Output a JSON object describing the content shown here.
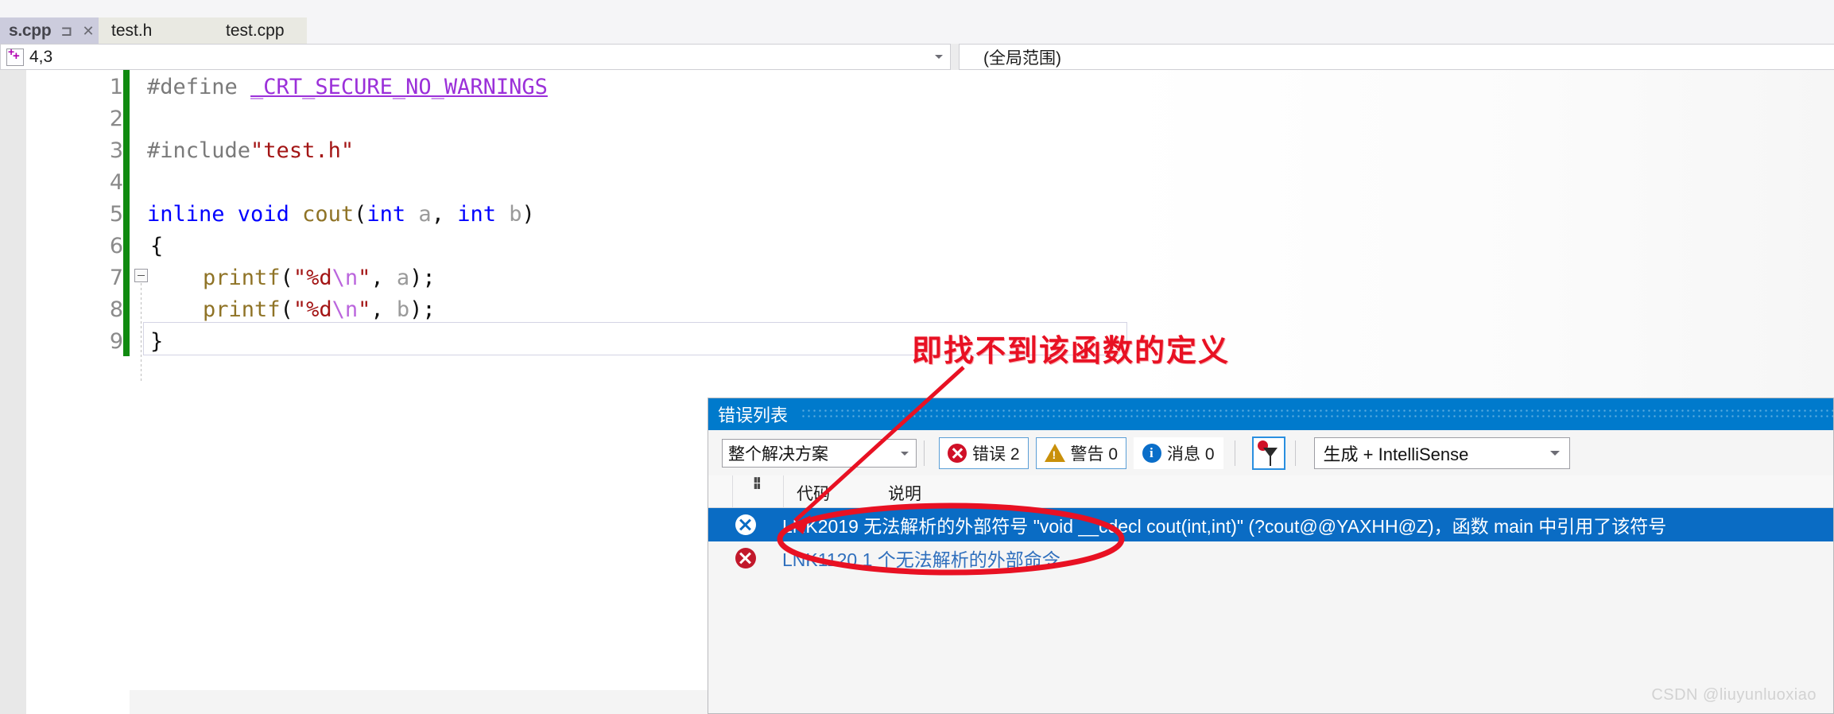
{
  "tabs": [
    {
      "label": "s.cpp",
      "active": true,
      "pin_icon": "pin-icon",
      "close_icon": "close-icon"
    },
    {
      "label": "test.h",
      "active": false
    },
    {
      "label": "test.cpp",
      "active": false
    }
  ],
  "navbar": {
    "left_value": "4,3",
    "left_icon": "member-list-icon",
    "right_value": "(全局范围)",
    "caret_icon": "chevron-down-icon"
  },
  "editor": {
    "line_numbers": [
      "1",
      "2",
      "3",
      "4",
      "5",
      "6",
      "7",
      "8",
      "9"
    ],
    "lines": [
      {
        "n": "1",
        "text": "#define _CRT_SECURE_NO_WARNINGS"
      },
      {
        "n": "2",
        "text": ""
      },
      {
        "n": "3",
        "text": "#include\"test.h\""
      },
      {
        "n": "4",
        "text": ""
      },
      {
        "n": "5",
        "text": "inline void cout(int a, int b)"
      },
      {
        "n": "6",
        "text": "{"
      },
      {
        "n": "7",
        "text": "    printf(\"%d\\n\", a);"
      },
      {
        "n": "8",
        "text": "    printf(\"%d\\n\", b);"
      },
      {
        "n": "9",
        "text": "}"
      }
    ],
    "tokens": {
      "l1_define": "#define ",
      "l1_macro": "_CRT_SECURE_NO_WARNINGS",
      "l3_include": "#include",
      "l3_file": "\"test.h\"",
      "l5_inline": "inline",
      "l5_void": " void ",
      "l5_fn": "cout",
      "l5_p1": "(",
      "l5_int1": "int",
      "l5_a": " a",
      "l5_comma": ", ",
      "l5_int2": "int",
      "l5_b": " b",
      "l5_p2": ")",
      "l6_brace": "{",
      "l7_fn": "printf",
      "l7_p1": "(",
      "l7_str": "\"%d",
      "l7_esc": "\\n",
      "l7_str2": "\"",
      "l7_comma": ", ",
      "l7_arg": "a",
      "l7_end": ");",
      "l8_arg": "b",
      "l9_brace": "}"
    },
    "fold_icon": "collapse-minus-icon",
    "change_bar_color": "#108a10"
  },
  "annotation": {
    "text": "即找不到该函数的定义",
    "color": "#e81123",
    "arrow_icon": "arrow-pointer",
    "ellipse_icon": "highlight-ellipse"
  },
  "error_panel": {
    "title": "错误列表",
    "scope_filter": {
      "value": "整个解决方案",
      "caret_icon": "chevron-down-icon"
    },
    "filters": [
      {
        "label": "错误 2",
        "icon": "error-icon",
        "count": 2
      },
      {
        "label": "警告 0",
        "icon": "warning-icon",
        "count": 0
      },
      {
        "label": "消息 0",
        "icon": "info-icon",
        "count": 0
      }
    ],
    "pin_filter_icon": "filter-pin-icon",
    "build_filter": {
      "value": "生成 + IntelliSense",
      "caret_icon": "chevron-down-icon"
    },
    "columns": [
      "",
      "",
      "代码",
      "说明"
    ],
    "rows": [
      {
        "icon": "error-icon",
        "code": "LNK2019",
        "description": "无法解析的外部符号 \"void __cdecl cout(int,int)\" (?cout@@YAXHH@Z)，函数 main 中引用了该符号",
        "full": "LNK2019  无法解析的外部符号 \"void __cdecl cout(int,int)\" (?cout@@YAXHH@Z)，函数 main 中引用了该符号",
        "selected": true
      },
      {
        "icon": "error-icon",
        "code": "LNK1120",
        "description": "1 个无法解析的外部命令",
        "full": "LNK1120  1 个无法解析的外部命令",
        "selected": false
      }
    ]
  },
  "watermark": "CSDN @liuyunluoxiao",
  "colors": {
    "accent_blue": "#007acc",
    "selection_blue": "#0a6cc4",
    "error_red": "#c2182b",
    "warning_amber": "#c9900a",
    "info_blue": "#0a6ec9",
    "change_green": "#108a10",
    "annotation_red": "#e81123"
  }
}
